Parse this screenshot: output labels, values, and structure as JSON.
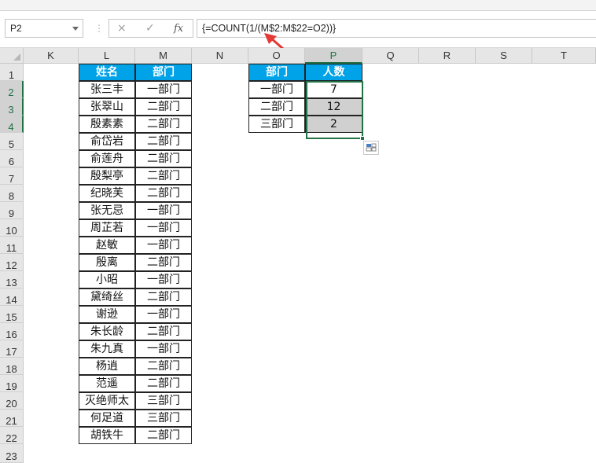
{
  "name_box": {
    "value": "P2"
  },
  "formula_bar": {
    "cancel_icon": "×",
    "enter_icon": "✓",
    "fx_label": "fx",
    "formula": "{=COUNT(1/(M$2:M$22=O2))}"
  },
  "columns": [
    "K",
    "L",
    "M",
    "N",
    "O",
    "P",
    "Q",
    "R",
    "S",
    "T"
  ],
  "rows": [
    "1",
    "2",
    "3",
    "4",
    "5",
    "6",
    "7",
    "8",
    "9",
    "10",
    "11",
    "12",
    "13",
    "14",
    "15",
    "16",
    "17",
    "18",
    "19",
    "20",
    "21",
    "22",
    "23"
  ],
  "active_cell": {
    "column": "P",
    "rows": [
      "2",
      "3",
      "4"
    ]
  },
  "table1": {
    "header_name": "姓名",
    "header_dept": "部门",
    "rows": [
      {
        "name": "张三丰",
        "dept": "一部门"
      },
      {
        "name": "张翠山",
        "dept": "二部门"
      },
      {
        "name": "殷素素",
        "dept": "二部门"
      },
      {
        "name": "俞岱岩",
        "dept": "二部门"
      },
      {
        "name": "俞莲舟",
        "dept": "二部门"
      },
      {
        "name": "殷梨亭",
        "dept": "二部门"
      },
      {
        "name": "纪晓芙",
        "dept": "二部门"
      },
      {
        "name": "张无忌",
        "dept": "一部门"
      },
      {
        "name": "周芷若",
        "dept": "一部门"
      },
      {
        "name": "赵敏",
        "dept": "一部门"
      },
      {
        "name": "殷离",
        "dept": "二部门"
      },
      {
        "name": "小昭",
        "dept": "一部门"
      },
      {
        "name": "黛绮丝",
        "dept": "二部门"
      },
      {
        "name": "谢逊",
        "dept": "一部门"
      },
      {
        "name": "朱长龄",
        "dept": "二部门"
      },
      {
        "name": "朱九真",
        "dept": "一部门"
      },
      {
        "name": "杨逍",
        "dept": "二部门"
      },
      {
        "name": "范遥",
        "dept": "二部门"
      },
      {
        "name": "灭绝师太",
        "dept": "三部门"
      },
      {
        "name": "何足道",
        "dept": "三部门"
      },
      {
        "name": "胡铁牛",
        "dept": "二部门"
      }
    ]
  },
  "table2": {
    "header_dept": "部门",
    "header_count": "人数",
    "rows": [
      {
        "dept": "一部门",
        "count": "7"
      },
      {
        "dept": "二部门",
        "count": "12"
      },
      {
        "dept": "三部门",
        "count": "2"
      }
    ]
  },
  "colors": {
    "header_fill": "#00a2e8",
    "selection": "#217346",
    "annotation_arrow": "#e53935"
  }
}
